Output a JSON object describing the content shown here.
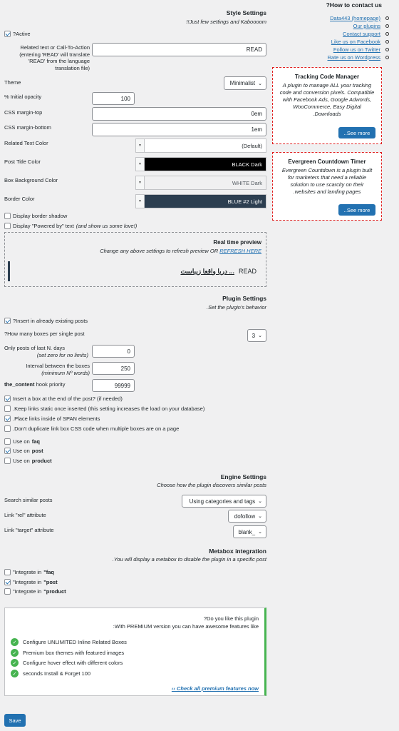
{
  "style": {
    "title": "Style Settings",
    "subtitle": "!!Just few settings and Kaboooom",
    "active_label": "?Active",
    "related_text_label": "Related text or Call-To-Action (entering 'READ' will translate 'READ' from the language translation file)",
    "related_text_value": "READ",
    "theme_label": "Theme",
    "theme_value": "Minimalist",
    "opacity_label": "% Initial opacity",
    "opacity_value": "100",
    "margin_top_label": "CSS margin-top",
    "margin_top_value": "0em",
    "margin_bottom_label": "CSS margin-bottom",
    "margin_bottom_value": "1em",
    "text_color_label": "Related Text Color",
    "text_color_value": "(Default)",
    "post_title_color_label": "Post Title Color",
    "post_title_color_value": "BLACK Dark",
    "box_bg_label": "Box Background Color",
    "box_bg_value": "WHITE Dark",
    "border_color_label": "Border Color",
    "border_color_value": "BLUE #2 Light",
    "border_shadow_label": "Display border shadow",
    "powered_by_label": "Display \"Powered by\" text",
    "powered_by_note": "(and show us some love!)"
  },
  "preview": {
    "title": "Real time preview",
    "subtitle": "Change any above settings to refresh preview OR",
    "refresh_link": "REFRESH HERE",
    "read_label": "READ",
    "post_title": "دریا واقعا زیباست ..."
  },
  "plugin": {
    "title": "Plugin Settings",
    "subtitle": ".Set the plugin's behavior",
    "insert_existing_label": "?Insert in already existing posts",
    "boxes_label": "?How many boxes per single post",
    "boxes_value": "3",
    "last_days_label": "Only posts of last N. days",
    "last_days_note": "(set zero for no limits)",
    "last_days_value": "0",
    "interval_label": "Interval between the boxes",
    "interval_note": "(minimum Nº words)",
    "interval_value": "250",
    "priority_label_code": "the_content",
    "priority_label": "hook priority",
    "priority_value": "99999",
    "end_box_label": "Insert a box at the end of the post? (if needed)",
    "static_links_label": ".Keep links static once inserted (this setting increases the load on your database)",
    "span_label": ".Place links inside of SPAN elements",
    "no_dup_css_label": ".Don't duplicate link box CSS code when multiple boxes are on a page",
    "use_on": "Use on",
    "faq": "faq",
    "post": "post",
    "product": "product"
  },
  "engine": {
    "title": "Engine Settings",
    "subtitle": "Choose how the plugin discovers similar posts",
    "search_label": "Search similar posts",
    "search_value": "Using categories and tags",
    "rel_label": "Link \"rel\" attribute",
    "rel_value": "dofollow",
    "target_label": "Link \"target\" attribute",
    "target_value": "blank_"
  },
  "metabox": {
    "title": "Metabox integration",
    "subtitle": ".You will display a metabox to disable the plugin in a specific post",
    "integrate_in": "Integrate in",
    "faq": "faq",
    "post": "post",
    "product": "product"
  },
  "premium": {
    "question": "?Do you like this plugin",
    "intro": ":With PREMIUM version you can have awesome features like",
    "features": [
      "Configure UNLIMITED Inline Related Boxes",
      "Premium box themes with featured images",
      "Configure hover effect with different colors",
      "seconds Install & Forget 100"
    ],
    "link": "‹‹ Check all premium features now"
  },
  "save_label": "Save",
  "sidebar": {
    "contact_title": "?How to contact us",
    "links": [
      "Data443 (homepage)",
      "Our plugins",
      "Contact support",
      "Like us on Facebook",
      "Follow us on Twitter",
      "Rate us on Wordpress"
    ],
    "promo1": {
      "title": "Tracking Code Manager",
      "text": "A plugin to manage ALL your tracking code and conversion pixels. Compatible with Facebook Ads, Google Adwords, WooCommerce, Easy Digital .Downloads",
      "button": "..See more"
    },
    "promo2": {
      "title": "Evergreen Countdown Timer",
      "text": "Evergreen Countdown is a plugin built for marketers that need a reliable solution to use scarcity on their .websites and landing pages",
      "button": "..See more"
    }
  },
  "colors": {
    "accent": "#2271b1",
    "black_swatch": "#000000",
    "white_swatch": "#f0f0f1",
    "blue_swatch": "#2c3e50",
    "promo_border": "#e02020",
    "premium_border": "#46b450"
  }
}
